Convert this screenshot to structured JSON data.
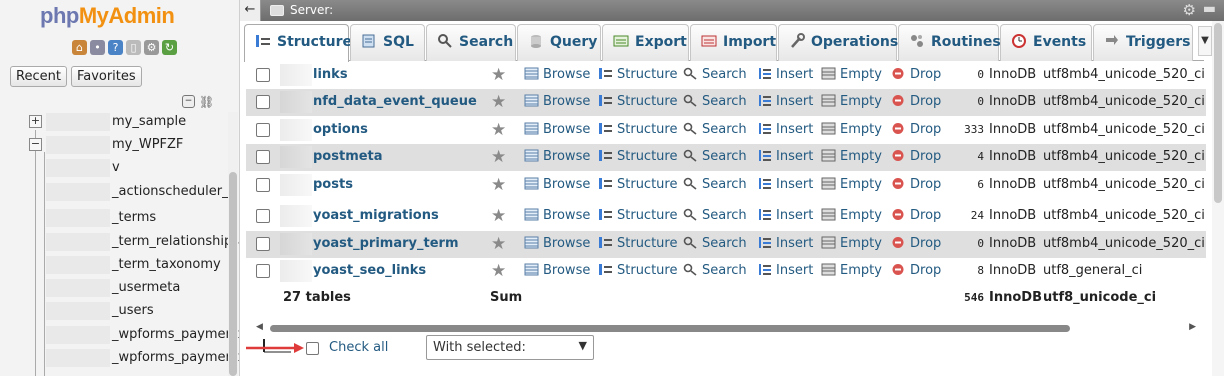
{
  "nav": {
    "logo_php": "php",
    "logo_admin": "MyAdmin",
    "recent": "Recent",
    "favorites": "Favorites",
    "tree": [
      {
        "label": "my_sample",
        "toggle": "+"
      },
      {
        "label": "my_WPFZF",
        "toggle": "−"
      },
      {
        "label": "v"
      },
      {
        "label": "_actionscheduler_a"
      },
      {
        "label": "_terms"
      },
      {
        "label": "_term_relationships"
      },
      {
        "label": "_term_taxonomy"
      },
      {
        "label": "_usermeta"
      },
      {
        "label": "_users"
      },
      {
        "label": "_wpforms_payment"
      },
      {
        "label": "_wpforms_payment"
      }
    ]
  },
  "serverbar": {
    "label": "Server:"
  },
  "tabs": [
    {
      "label": "Structure",
      "icon": "structure-icon"
    },
    {
      "label": "SQL",
      "icon": "sql-icon"
    },
    {
      "label": "Search",
      "icon": "search-icon"
    },
    {
      "label": "Query",
      "icon": "query-icon"
    },
    {
      "label": "Export",
      "icon": "export-icon"
    },
    {
      "label": "Import",
      "icon": "import-icon"
    },
    {
      "label": "Operations",
      "icon": "wrench-icon"
    },
    {
      "label": "Routines",
      "icon": "routines-icon"
    },
    {
      "label": "Events",
      "icon": "clock-icon"
    },
    {
      "label": "Triggers",
      "icon": "triggers-icon"
    }
  ],
  "actions": {
    "browse": "Browse",
    "structure": "Structure",
    "search": "Search",
    "insert": "Insert",
    "empty": "Empty",
    "drop": "Drop"
  },
  "rows": [
    {
      "name": "links",
      "rows": "0",
      "engine": "InnoDB",
      "collation": "utf8mb4_unicode_520_ci"
    },
    {
      "name": "nfd_data_event_queue",
      "rows": "0",
      "engine": "InnoDB",
      "collation": "utf8mb4_unicode_520_ci"
    },
    {
      "name": "options",
      "rows": "333",
      "engine": "InnoDB",
      "collation": "utf8mb4_unicode_520_ci"
    },
    {
      "name": "postmeta",
      "rows": "4",
      "engine": "InnoDB",
      "collation": "utf8mb4_unicode_520_ci"
    },
    {
      "name": "posts",
      "rows": "6",
      "engine": "InnoDB",
      "collation": "utf8mb4_unicode_520_ci"
    },
    {
      "name": "yoast_migrations",
      "rows": "24",
      "engine": "InnoDB",
      "collation": "utf8mb4_unicode_520_ci"
    },
    {
      "name": "yoast_primary_term",
      "rows": "0",
      "engine": "InnoDB",
      "collation": "utf8mb4_unicode_520_ci"
    },
    {
      "name": "yoast_seo_links",
      "rows": "8",
      "engine": "InnoDB",
      "collation": "utf8_general_ci"
    }
  ],
  "summary": {
    "tables": "27 tables",
    "sum": "Sum",
    "rows": "546",
    "engine": "InnoDB",
    "collation": "utf8_unicode_ci"
  },
  "footer": {
    "check_all": "Check all",
    "with_selected": "With selected:"
  },
  "colors": {
    "link": "#235a81",
    "drop": "#cc3333",
    "arrow": "#e03b3b"
  }
}
